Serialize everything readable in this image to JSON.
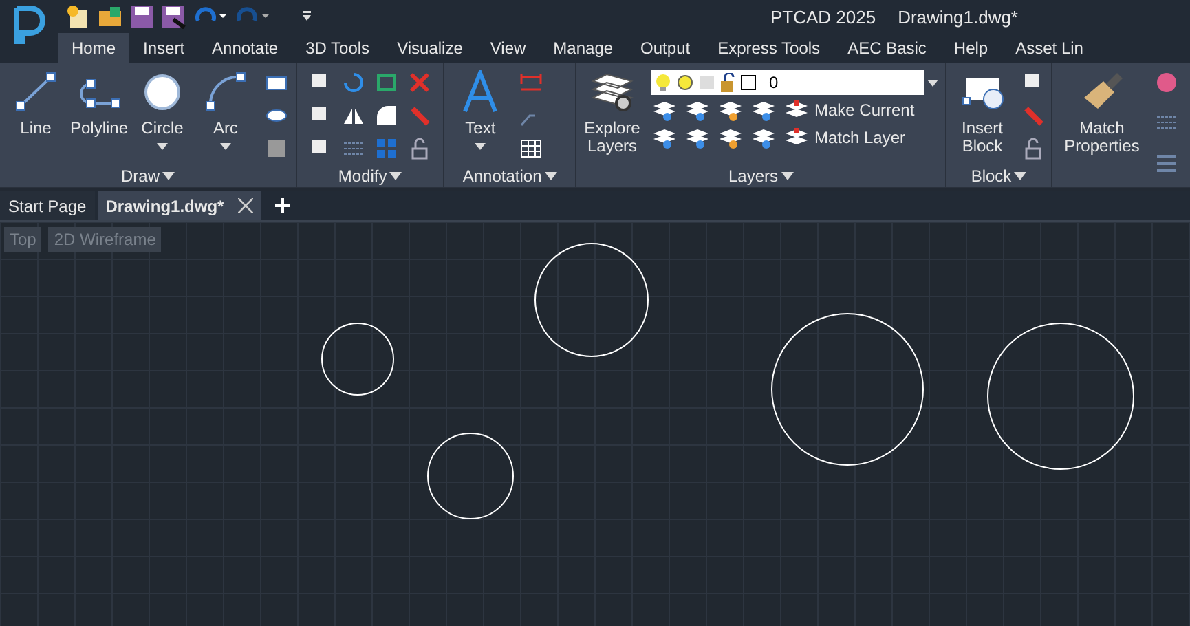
{
  "app_title": "PTCAD  2025",
  "document_title": "Drawing1.dwg*",
  "ribbon_tabs": [
    {
      "label": "Home",
      "selected": true
    },
    {
      "label": "Insert",
      "selected": false
    },
    {
      "label": "Annotate",
      "selected": false
    },
    {
      "label": "3D Tools",
      "selected": false
    },
    {
      "label": "Visualize",
      "selected": false
    },
    {
      "label": "View",
      "selected": false
    },
    {
      "label": "Manage",
      "selected": false
    },
    {
      "label": "Output",
      "selected": false
    },
    {
      "label": "Express Tools",
      "selected": false
    },
    {
      "label": "AEC Basic",
      "selected": false
    },
    {
      "label": "Help",
      "selected": false
    },
    {
      "label": "Asset Lin",
      "selected": false
    }
  ],
  "panels": [
    {
      "kind": "draw",
      "title": "Draw",
      "tools": [
        {
          "kind": "line",
          "label": "Line",
          "dropdown": false
        },
        {
          "kind": "polyline",
          "label": "Polyline",
          "dropdown": false
        },
        {
          "kind": "circle",
          "label": "Circle",
          "dropdown": true
        },
        {
          "kind": "arc",
          "label": "Arc",
          "dropdown": true
        }
      ]
    },
    {
      "kind": "modify",
      "title": "Modify"
    },
    {
      "kind": "annotation",
      "title": "Annotation",
      "tools": [
        {
          "kind": "text",
          "label": "Text",
          "dropdown": true
        }
      ]
    },
    {
      "kind": "layers",
      "title": "Layers",
      "tools": [
        {
          "kind": "explore",
          "label": "Explore Layers",
          "dropdown": false
        }
      ],
      "layer_value": "0",
      "actions": [
        "Make Current",
        "Match Layer"
      ]
    },
    {
      "kind": "block",
      "title": "Block",
      "tools": [
        {
          "kind": "insert",
          "label": "Insert Block",
          "dropdown": false
        }
      ]
    },
    {
      "kind": "properties",
      "tools": [
        {
          "kind": "match",
          "label": "Match Properties",
          "dropdown": false
        }
      ]
    }
  ],
  "document_tabs": [
    {
      "label": "Start Page",
      "selected": false,
      "closable": false
    },
    {
      "label": "Drawing1.dwg*",
      "selected": true,
      "closable": true
    }
  ],
  "viewport_labels": [
    "Top",
    "2D Wireframe"
  ]
}
